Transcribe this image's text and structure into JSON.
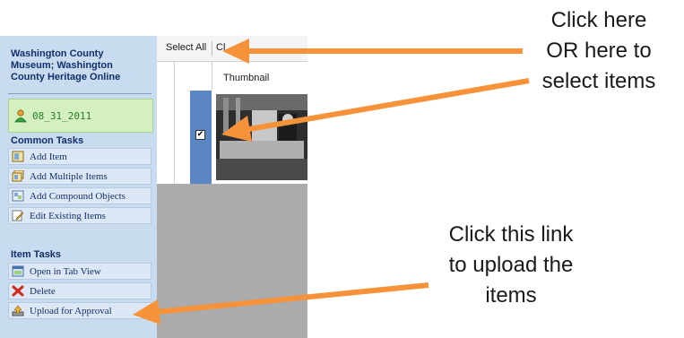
{
  "task_pane": {
    "title": "Washington County Museum; Washington County Heritage Online",
    "project": "08_31_2011",
    "common_tasks_title": "Common Tasks",
    "common_tasks": [
      {
        "label": "Add Item",
        "icon": "add-item-icon"
      },
      {
        "label": "Add Multiple Items",
        "icon": "add-multiple-items-icon"
      },
      {
        "label": "Add Compound Objects",
        "icon": "add-compound-objects-icon"
      },
      {
        "label": "Edit Existing Items",
        "icon": "edit-items-icon"
      }
    ],
    "item_tasks_title": "Item Tasks",
    "item_tasks": [
      {
        "label": "Open in Tab View",
        "icon": "tab-view-icon"
      },
      {
        "label": "Delete",
        "icon": "delete-icon"
      },
      {
        "label": "Upload for Approval",
        "icon": "upload-icon"
      }
    ]
  },
  "grid": {
    "toolbar": {
      "select_all": "Select All",
      "clear_partial": "Cl"
    },
    "column_thumbnail": "Thumbnail",
    "row_checked": "✔"
  },
  "callouts": {
    "select_lines": [
      "Click here",
      "OR here to",
      "select items"
    ],
    "upload_lines": [
      "Click this link",
      "to upload the",
      "items"
    ]
  },
  "colors": {
    "arrow": "#f5923a",
    "pane_bg": "#c9dbef",
    "selected_row": "#5b86c6"
  }
}
